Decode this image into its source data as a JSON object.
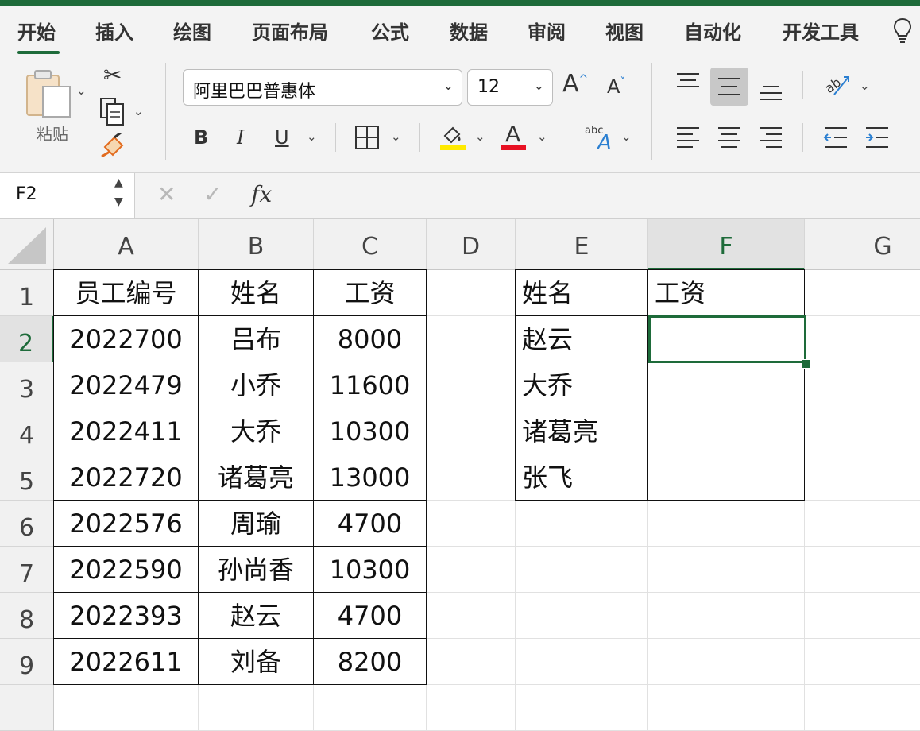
{
  "ribbon_tabs": [
    "开始",
    "插入",
    "绘图",
    "页面布局",
    "公式",
    "数据",
    "审阅",
    "视图",
    "自动化",
    "开发工具"
  ],
  "clipboard": {
    "paste_label": "粘贴"
  },
  "font": {
    "name": "阿里巴巴普惠体",
    "size": "12"
  },
  "format_buttons": {
    "bold": "B",
    "italic": "I",
    "underline": "U",
    "font_color_letter": "A",
    "grow": "A",
    "shrink": "A",
    "wrap_top": "abc",
    "wrap_letter": "A"
  },
  "formula_bar": {
    "name_box": "F2",
    "cancel": "✕",
    "enter": "✓",
    "fx": "fx",
    "value": ""
  },
  "colors": {
    "accent": "#1e6b3a",
    "fill_color": "#ffea00",
    "font_color": "#e81123"
  },
  "grid": {
    "columns": [
      "A",
      "B",
      "C",
      "D",
      "E",
      "F",
      "G"
    ],
    "rows": [
      "1",
      "2",
      "3",
      "4",
      "5",
      "6",
      "7",
      "8",
      "9"
    ],
    "active_column": "F",
    "active_row": "2",
    "table1": {
      "headers": [
        "员工编号",
        "姓名",
        "工资"
      ],
      "rows": [
        [
          "2022700",
          "吕布",
          "8000"
        ],
        [
          "2022479",
          "小乔",
          "11600"
        ],
        [
          "2022411",
          "大乔",
          "10300"
        ],
        [
          "2022720",
          "诸葛亮",
          "13000"
        ],
        [
          "2022576",
          "周瑜",
          "4700"
        ],
        [
          "2022590",
          "孙尚香",
          "10300"
        ],
        [
          "2022393",
          "赵云",
          "4700"
        ],
        [
          "2022611",
          "刘备",
          "8200"
        ]
      ]
    },
    "table2": {
      "headers": [
        "姓名",
        "工资"
      ],
      "rows": [
        [
          "赵云",
          ""
        ],
        [
          "大乔",
          ""
        ],
        [
          "诸葛亮",
          ""
        ],
        [
          "张飞",
          ""
        ]
      ]
    }
  }
}
